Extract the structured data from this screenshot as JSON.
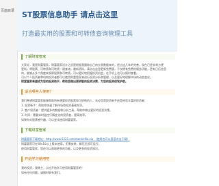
{
  "sidebar": {
    "label": "页面目录"
  },
  "hero": {
    "title": "ST股票信息助手 请点击这里",
    "subtitle": "打造最实用的股票和可转债查询管理工具"
  },
  "sections": {
    "about": {
      "heading": "了解财富管家",
      "lines": [
        "大家好，我是财富管家，财富管家设计之初是根据我跟踪自己的交易数据来的，经过这几年的完善，现在已经非常方便",
        "更新。将股票、可转债和可转债一键查询，最新资料，请点击这里更新免费版，不仅拥有免费的服务功能，更有日历信息",
        "的，能够从多个角度来观察股票和可转债，可以更好地把握投资机会，在手机上也可以随时查看。",
        "可以个人投资者和机构投资者都可以使用财富管家来进行投资分析和管理，以及更好地理解市场的动态变化。",
        "财富管家希望成为您的投资助手，帮助您做出更明智的投资决策，为您的投资保驾护航。"
      ]
    },
    "features": {
      "heading": "适合哪些人使用？",
      "lines": [
        "我们希望财富管家能够帮助所有想要投资股票和可转债的人，无论您是投资新手还是经验丰富的投资者：",
        "1. 投资新手：帮助你快速了解市场和投资基础知识。",
        "2. 散户投资者：提供更多的数据和分析工具，帮助你做出更好的投资决策。",
        "3. 时间：需要实时监控行情变化的投资者，提高效率。",
        "如果你对股票感兴趣，可以尝试使用财富管家。"
      ]
    },
    "download": {
      "heading": "下载财富管家",
      "lines": [
        "财富管家下载地址：http://www.5221.net/stock/cfwl.zip （使用也可以直接点击下载）",
        "财富管家可在Win10以上版本使用，无需安装，解压后即可运行。",
        "使用财富管家，您还可以获取更多的功能，以及更多的投资知识。"
      ]
    },
    "start": {
      "heading": "开始学习使用吧",
      "lines": [
        "我的投资，我做主，点击开始学习使用财富管家吧！",
        "如有任何问题，请随时联系我们。"
      ]
    }
  },
  "colors": {
    "hero_title": "#2d5d8e",
    "section_green": "#7db24a",
    "section_orange": "#e59a39",
    "link": "#3b74b5"
  }
}
